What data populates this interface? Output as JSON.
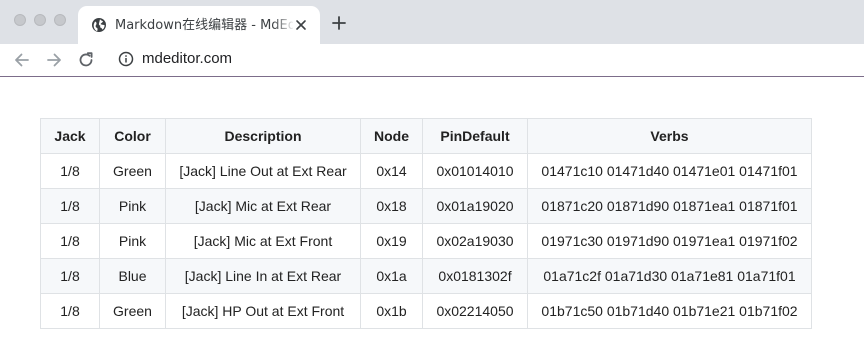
{
  "browser": {
    "tab": {
      "title": "Markdown在线编辑器 - MdEditor"
    },
    "address_bar": {
      "url": "mdeditor.com"
    }
  },
  "table": {
    "headers": [
      "Jack",
      "Color",
      "Description",
      "Node",
      "PinDefault",
      "Verbs"
    ],
    "rows": [
      [
        "1/8",
        "Green",
        "[Jack] Line Out at Ext Rear",
        "0x14",
        "0x01014010",
        "01471c10 01471d40 01471e01 01471f01"
      ],
      [
        "1/8",
        "Pink",
        "[Jack] Mic at Ext Rear",
        "0x18",
        "0x01a19020",
        "01871c20 01871d90 01871ea1 01871f01"
      ],
      [
        "1/8",
        "Pink",
        "[Jack] Mic at Ext Front",
        "0x19",
        "0x02a19030",
        "01971c30 01971d90 01971ea1 01971f02"
      ],
      [
        "1/8",
        "Blue",
        "[Jack] Line In at Ext Rear",
        "0x1a",
        "0x0181302f",
        "01a71c2f 01a71d30 01a71e81 01a71f01"
      ],
      [
        "1/8",
        "Green",
        "[Jack] HP Out at Ext Front",
        "0x1b",
        "0x02214050",
        "01b71c50 01b71d40 01b71e21 01b71f02"
      ]
    ]
  }
}
